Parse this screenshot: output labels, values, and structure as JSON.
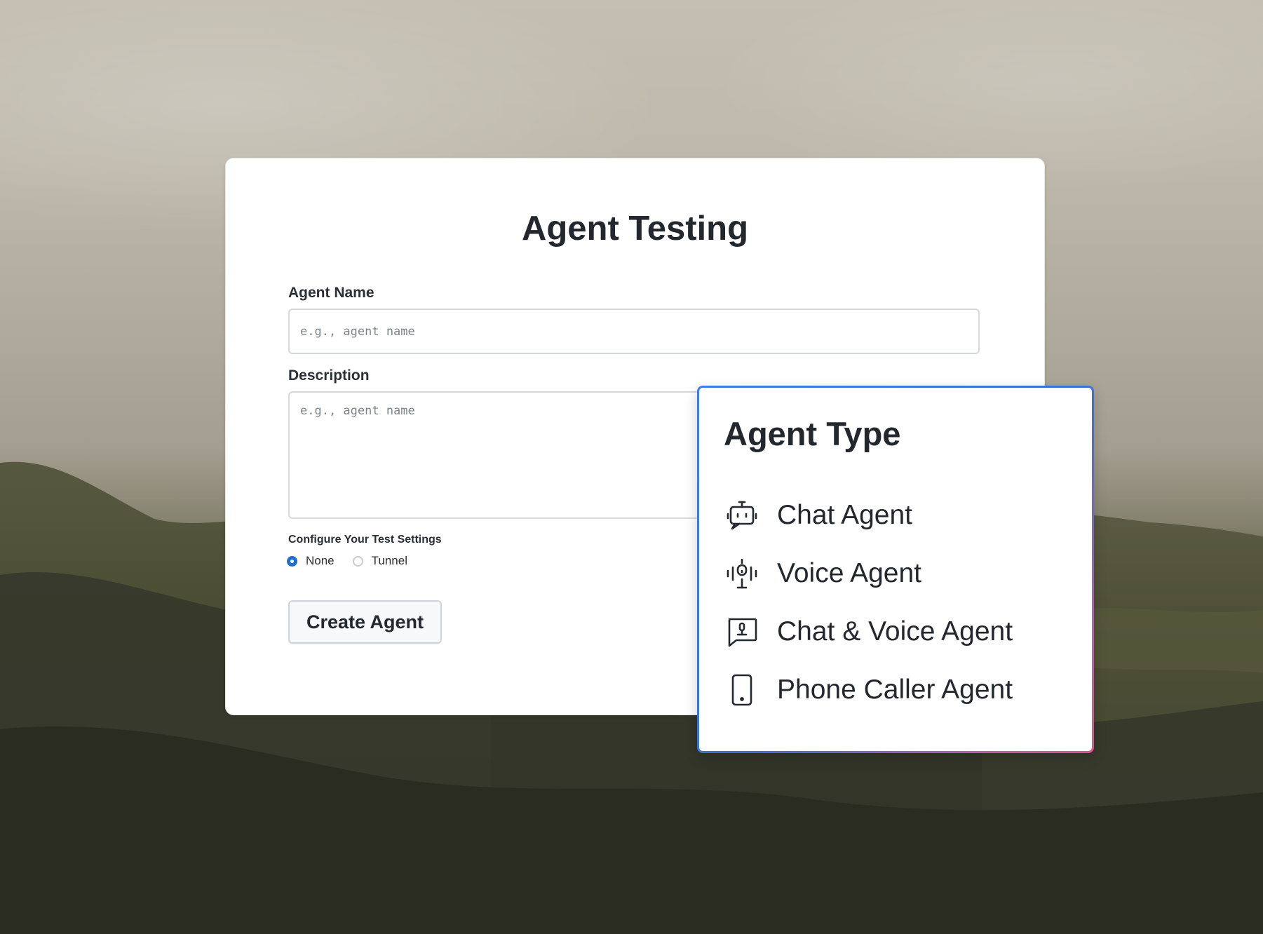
{
  "form": {
    "title": "Agent Testing",
    "agent_name_label": "Agent Name",
    "agent_name_placeholder": "e.g., agent name",
    "agent_name_value": "",
    "description_label": "Description",
    "description_placeholder": "e.g., agent name",
    "description_value": "",
    "settings_label": "Configure Your Test Settings",
    "settings_options": [
      {
        "label": "None",
        "selected": true
      },
      {
        "label": "Tunnel",
        "selected": false
      }
    ],
    "create_button_label": "Create Agent"
  },
  "agent_type_menu": {
    "title": "Agent Type",
    "items": [
      {
        "label": "Chat Agent",
        "icon": "robot-icon"
      },
      {
        "label": "Voice Agent",
        "icon": "microphone-icon"
      },
      {
        "label": "Chat & Voice Agent",
        "icon": "speech-bubble-mic-icon"
      },
      {
        "label": "Phone Caller Agent",
        "icon": "phone-icon"
      }
    ]
  },
  "colors": {
    "accent": "#1d6fd6",
    "popover_border_start": "#3f7fe0",
    "popover_border_end": "#e0528a",
    "text": "#23282e"
  }
}
